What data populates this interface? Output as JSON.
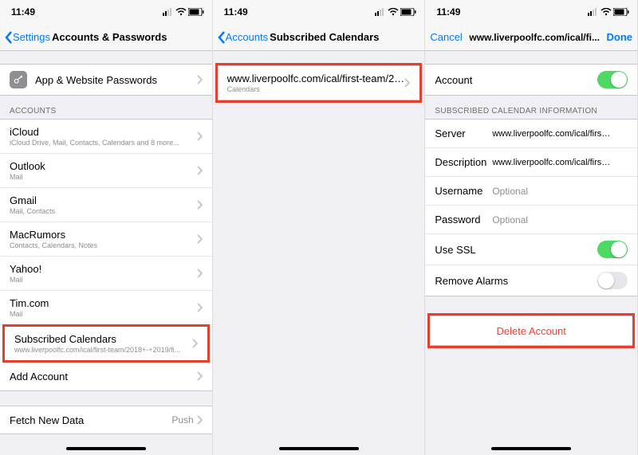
{
  "status": {
    "time": "11:49"
  },
  "pane1": {
    "nav": {
      "back": "Settings",
      "title": "Accounts & Passwords"
    },
    "appPasswords": {
      "label": "App & Website Passwords"
    },
    "accountsHeader": "ACCOUNTS",
    "accounts": [
      {
        "name": "iCloud",
        "detail": "iCloud Drive, Mail, Contacts, Calendars and 8 more..."
      },
      {
        "name": "Outlook",
        "detail": "Mail"
      },
      {
        "name": "Gmail",
        "detail": "Mail, Contacts"
      },
      {
        "name": "MacRumors",
        "detail": "Contacts, Calendars, Notes"
      },
      {
        "name": "Yahoo!",
        "detail": "Mail"
      },
      {
        "name": "Tim.com",
        "detail": "Mail"
      },
      {
        "name": "Subscribed Calendars",
        "detail": "www.liverpoolfc.com/ical/first-team/2018+-+2019/fi..."
      }
    ],
    "addAccount": "Add Account",
    "fetch": {
      "label": "Fetch New Data",
      "value": "Push"
    }
  },
  "pane2": {
    "nav": {
      "back": "Accounts",
      "title": "Subscribed Calendars"
    },
    "cal": {
      "name": "www.liverpoolfc.com/ical/first-team/201...",
      "detail": "Calendars"
    }
  },
  "pane3": {
    "nav": {
      "cancel": "Cancel",
      "title": "www.liverpoolfc.com/ical/fi...",
      "done": "Done"
    },
    "accountRow": {
      "label": "Account",
      "on": true
    },
    "infoHeader": "SUBSCRIBED CALENDAR INFORMATION",
    "server": {
      "label": "Server",
      "value": "www.liverpoolfc.com/ical/first-team/..."
    },
    "description": {
      "label": "Description",
      "value": "www.liverpoolfc.com/ical/first-team/..."
    },
    "username": {
      "label": "Username",
      "placeholder": "Optional"
    },
    "password": {
      "label": "Password",
      "placeholder": "Optional"
    },
    "ssl": {
      "label": "Use SSL",
      "on": true
    },
    "alarms": {
      "label": "Remove Alarms",
      "on": false
    },
    "delete": "Delete Account"
  }
}
